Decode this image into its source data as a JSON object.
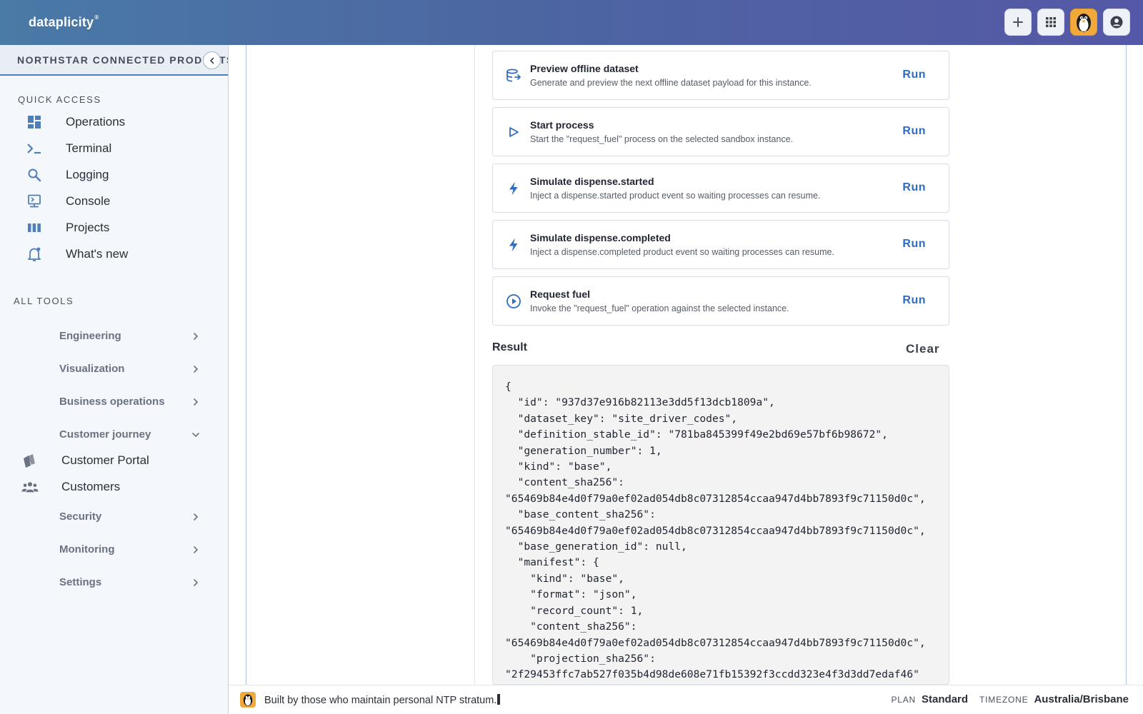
{
  "app": {
    "brand": "dataplicity",
    "brand_mark": "®"
  },
  "topbar": {
    "add_icon": "plus-icon",
    "apps_icon": "grid-icon",
    "avatar_icon": "penguin-icon",
    "account_icon": "user-circle-icon"
  },
  "sidebar": {
    "org_name": "NORTHSTAR CONNECTED PRODUCTS",
    "quick_access_label": "QUICK ACCESS",
    "quick_access": [
      {
        "label": "Operations",
        "icon": "dashboard-icon"
      },
      {
        "label": "Terminal",
        "icon": "terminal-icon"
      },
      {
        "label": "Logging",
        "icon": "search-icon"
      },
      {
        "label": "Console",
        "icon": "console-icon"
      },
      {
        "label": "Projects",
        "icon": "columns-icon"
      },
      {
        "label": "What's new",
        "icon": "bell-icon"
      }
    ],
    "all_tools_label": "ALL TOOLS",
    "tools": [
      {
        "label": "Engineering",
        "expanded": false
      },
      {
        "label": "Visualization",
        "expanded": false
      },
      {
        "label": "Business operations",
        "expanded": false
      },
      {
        "label": "Customer journey",
        "expanded": true
      },
      {
        "label": "Security",
        "expanded": false
      },
      {
        "label": "Monitoring",
        "expanded": false
      },
      {
        "label": "Settings",
        "expanded": false
      }
    ],
    "customer_journey_items": [
      {
        "label": "Customer Portal",
        "icon": "portal-icon"
      },
      {
        "label": "Customers",
        "icon": "people-icon"
      }
    ]
  },
  "actions": [
    {
      "title": "Preview offline dataset",
      "description": "Generate and preview the next offline dataset payload for this instance.",
      "run_label": "Run",
      "icon": "dataset-icon"
    },
    {
      "title": "Start process",
      "description": "Start the \"request_fuel\" process on the selected sandbox instance.",
      "run_label": "Run",
      "icon": "play-icon"
    },
    {
      "title": "Simulate dispense.started",
      "description": "Inject a dispense.started product event so waiting processes can resume.",
      "run_label": "Run",
      "icon": "bolt-icon"
    },
    {
      "title": "Simulate dispense.completed",
      "description": "Inject a dispense.completed product event so waiting processes can resume.",
      "run_label": "Run",
      "icon": "bolt-icon"
    },
    {
      "title": "Request fuel",
      "description": "Invoke the \"request_fuel\" operation against the selected instance.",
      "run_label": "Run",
      "icon": "play-circle-icon"
    }
  ],
  "result": {
    "title": "Result",
    "clear_label": "Clear",
    "json_text": "{\n  \"id\": \"937d37e916b82113e3dd5f13dcb1809a\",\n  \"dataset_key\": \"site_driver_codes\",\n  \"definition_stable_id\": \"781ba845399f49e2bd69e57bf6b98672\",\n  \"generation_number\": 1,\n  \"kind\": \"base\",\n  \"content_sha256\":\n\"65469b84e4d0f79a0ef02ad054db8c07312854ccaa947d4bb7893f9c71150d0c\",\n  \"base_content_sha256\":\n\"65469b84e4d0f79a0ef02ad054db8c07312854ccaa947d4bb7893f9c71150d0c\",\n  \"base_generation_id\": null,\n  \"manifest\": {\n    \"kind\": \"base\",\n    \"format\": \"json\",\n    \"record_count\": 1,\n    \"content_sha256\":\n\"65469b84e4d0f79a0ef02ad054db8c07312854ccaa947d4bb7893f9c71150d0c\",\n    \"projection_sha256\":\n\"2f29453ffc7ab527f035b4d98de608e71fb15392f3ccdd323e4f3d3dd7edaf46\""
  },
  "footer": {
    "message": "Built by those who maintain personal NTP stratum.",
    "plan_label": "PLAN",
    "plan_value": "Standard",
    "timezone_label": "TIMEZONE",
    "timezone_value": "Australia/Brisbane"
  },
  "colors": {
    "accent": "#2f6bc3",
    "topbar_start": "#4a7aa6",
    "topbar_end": "#5558a6",
    "sidebar_bg": "#f4f7fb",
    "avatar_bg": "#f2a93b"
  }
}
